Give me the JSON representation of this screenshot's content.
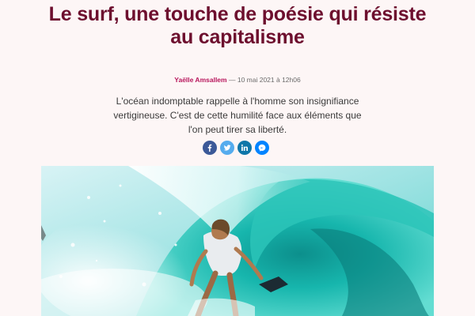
{
  "article": {
    "title": "Le surf, une touche de poésie qui résiste au capitalisme",
    "author": "Yaëlle Amsallem",
    "separator": "—",
    "date": "10 mai 2021 à 12h06",
    "lede": "L'océan indomptable rappelle à l'homme son insignifiance vertigineuse. C'est de cette humilité face aux éléments que l'on peut tirer sa liberté."
  },
  "share": [
    {
      "icon": "facebook-icon",
      "color": "#3b5998"
    },
    {
      "icon": "twitter-icon",
      "color": "#55acee"
    },
    {
      "icon": "linkedin-icon",
      "color": "#0e76a8"
    },
    {
      "icon": "messenger-icon",
      "color": "#0084ff"
    }
  ],
  "colors": {
    "title": "#6d0f2e",
    "author": "#b8165c",
    "background": "#fdf6f6"
  }
}
